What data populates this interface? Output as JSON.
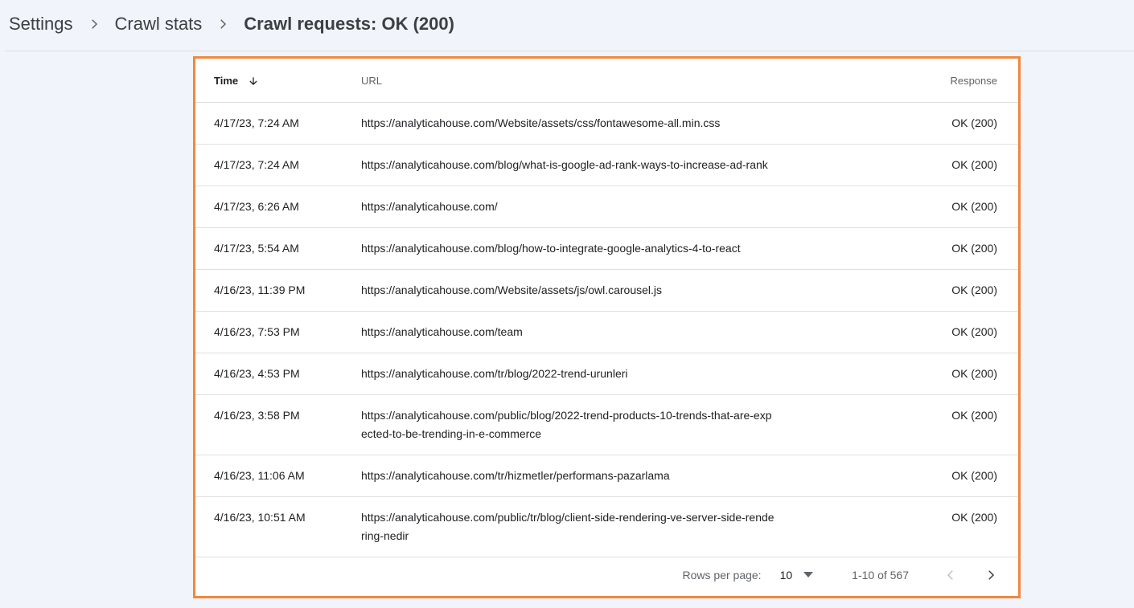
{
  "breadcrumb": {
    "items": [
      "Settings",
      "Crawl stats"
    ],
    "current": "Crawl requests: OK (200)"
  },
  "table": {
    "columns": {
      "time": "Time",
      "url": "URL",
      "response": "Response"
    },
    "rows": [
      {
        "time": "4/17/23, 7:24 AM",
        "url": "https://analyticahouse.com/Website/assets/css/fontawesome-all.min.css",
        "response": "OK (200)"
      },
      {
        "time": "4/17/23, 7:24 AM",
        "url": "https://analyticahouse.com/blog/what-is-google-ad-rank-ways-to-increase-ad-rank",
        "response": "OK (200)"
      },
      {
        "time": "4/17/23, 6:26 AM",
        "url": "https://analyticahouse.com/",
        "response": "OK (200)"
      },
      {
        "time": "4/17/23, 5:54 AM",
        "url": "https://analyticahouse.com/blog/how-to-integrate-google-analytics-4-to-react",
        "response": "OK (200)"
      },
      {
        "time": "4/16/23, 11:39 PM",
        "url": "https://analyticahouse.com/Website/assets/js/owl.carousel.js",
        "response": "OK (200)"
      },
      {
        "time": "4/16/23, 7:53 PM",
        "url": "https://analyticahouse.com/team",
        "response": "OK (200)"
      },
      {
        "time": "4/16/23, 4:53 PM",
        "url": "https://analyticahouse.com/tr/blog/2022-trend-urunleri",
        "response": "OK (200)"
      },
      {
        "time": "4/16/23, 3:58 PM",
        "url": "https://analyticahouse.com/public/blog/2022-trend-products-10-trends-that-are-expected-to-be-trending-in-e-commerce",
        "response": "OK (200)"
      },
      {
        "time": "4/16/23, 11:06 AM",
        "url": "https://analyticahouse.com/tr/hizmetler/performans-pazarlama",
        "response": "OK (200)"
      },
      {
        "time": "4/16/23, 10:51 AM",
        "url": "https://analyticahouse.com/public/tr/blog/client-side-rendering-ve-server-side-rendering-nedir",
        "response": "OK (200)"
      }
    ]
  },
  "pagination": {
    "rows_per_page_label": "Rows per page:",
    "rows_per_page_value": "10",
    "range": "1-10 of 567"
  },
  "icons": {
    "breadcrumb_separator": "chevron-right-icon",
    "sort": "arrow-down-icon",
    "dropdown": "caret-down-icon",
    "prev": "chevron-left-icon",
    "next": "chevron-right-icon"
  },
  "colors": {
    "highlight_border": "#f0883e",
    "background": "#f1f4fb"
  }
}
